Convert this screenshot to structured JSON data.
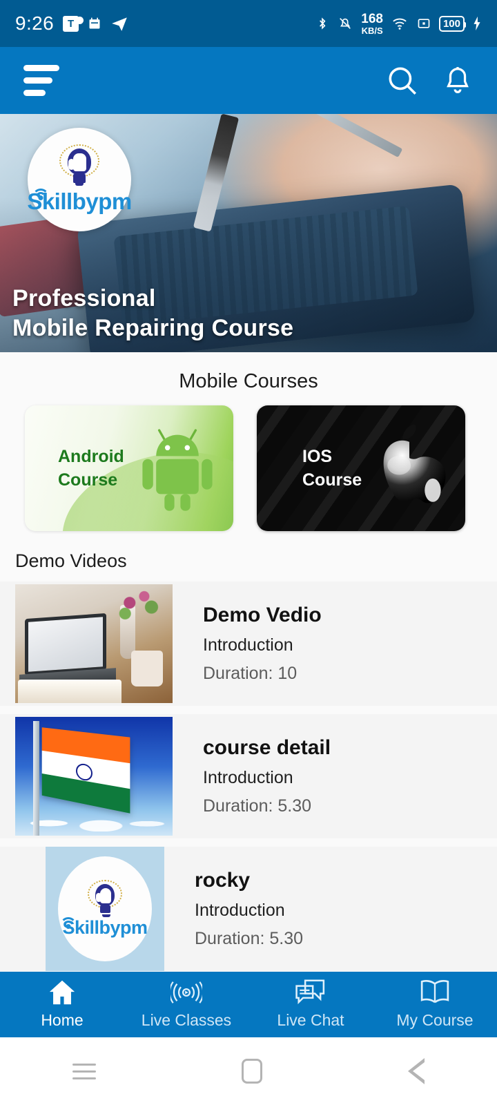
{
  "status_bar": {
    "time": "9:26",
    "left_icons": [
      "teams-icon",
      "calendar-icon",
      "telegram-icon"
    ],
    "network_speed_value": "168",
    "network_speed_unit": "KB/S",
    "battery_level": "100",
    "right_icons": [
      "bluetooth-icon",
      "vibrate-icon",
      "wifi-icon",
      "cast-icon",
      "battery-icon",
      "charging-bolt-icon"
    ]
  },
  "appbar": {
    "menu_icon": "hamburger-menu-icon",
    "search_icon": "search-icon",
    "notification_icon": "bell-icon"
  },
  "banner": {
    "logo_text": "Skillbypm",
    "title_line1": "Professional",
    "title_line2": "Mobile Repairing Course"
  },
  "sections": {
    "courses_title": "Mobile Courses",
    "demo_title": "Demo Videos"
  },
  "courses": [
    {
      "label_line1": "Android",
      "label_line2": "Course",
      "icon": "android-robot-icon",
      "theme": "green"
    },
    {
      "label_line1": "IOS",
      "label_line2": "Course",
      "icon": "apple-logo-icon",
      "theme": "black"
    }
  ],
  "demo_videos": [
    {
      "title": "Demo Vedio",
      "subtitle": "Introduction",
      "duration": "Duration: 10",
      "thumb": "laptop-desk-photo"
    },
    {
      "title": "course detail",
      "subtitle": "Introduction",
      "duration": "Duration: 5.30",
      "thumb": "india-flag-photo"
    },
    {
      "title": "rocky",
      "subtitle": "Introduction",
      "duration": "Duration: 5.30",
      "thumb": "skillbypm-logo-photo"
    }
  ],
  "bottom_nav": [
    {
      "label": "Home",
      "icon": "home-icon",
      "active": true
    },
    {
      "label": "Live Classes",
      "icon": "broadcast-icon",
      "active": false
    },
    {
      "label": "Live Chat",
      "icon": "chat-bubbles-icon",
      "active": false
    },
    {
      "label": "My Course",
      "icon": "open-book-icon",
      "active": false
    }
  ],
  "system_nav": {
    "recents_label": "recents-button",
    "home_label": "home-button",
    "back_label": "back-button"
  },
  "colors": {
    "status_bar": "#015B92",
    "app_bar": "#0577C0",
    "accent": "#0577C0",
    "page_bg": "#FAFAFA",
    "card_bg": "#F4F4F4",
    "android_green": "#1d7a1d"
  }
}
